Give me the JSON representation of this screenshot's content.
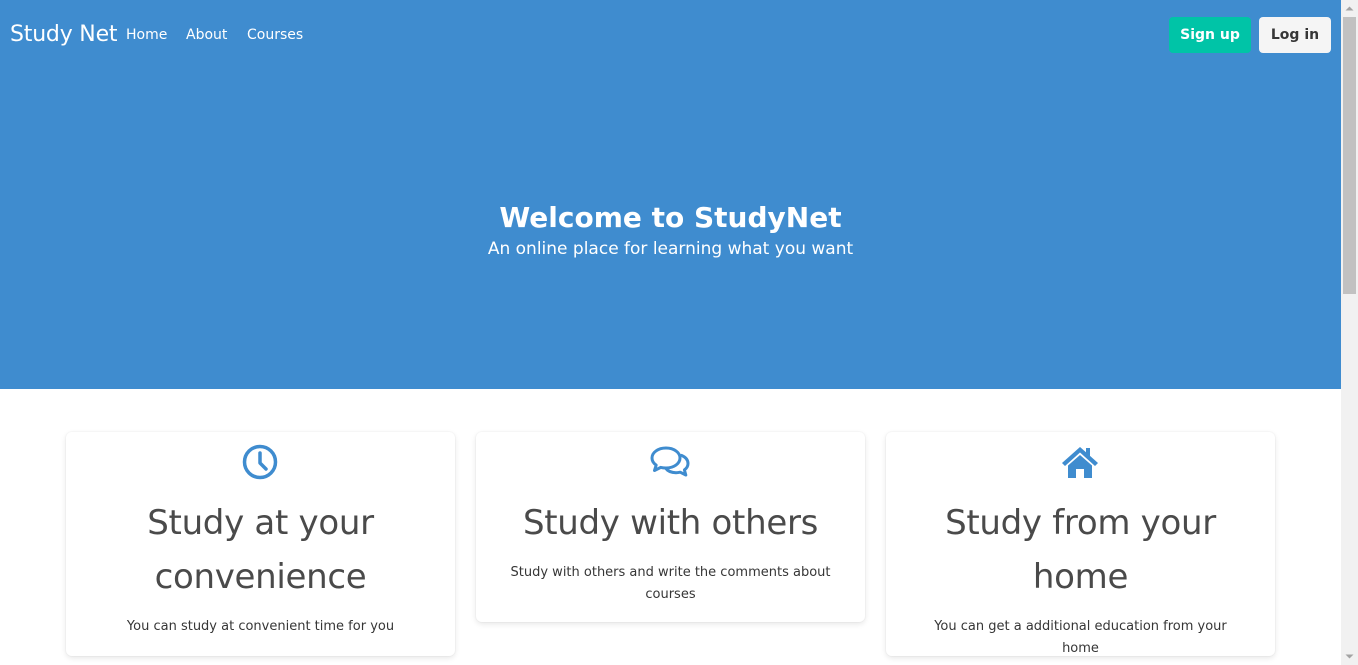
{
  "navbar": {
    "brand": "Study Net",
    "links": [
      {
        "label": "Home"
      },
      {
        "label": "About"
      },
      {
        "label": "Courses"
      }
    ],
    "signup_label": "Sign up",
    "login_label": "Log in"
  },
  "hero": {
    "title": "Welcome to StudyNet",
    "subtitle": "An online place for learning what you want"
  },
  "features": [
    {
      "icon": "clock-icon",
      "title": "Study at your convenience",
      "text": "You can study at convenient time for you"
    },
    {
      "icon": "comments-icon",
      "title": "Study with others",
      "text": "Study with others and write the comments about courses"
    },
    {
      "icon": "home-icon",
      "title": "Study from your home",
      "text": "You can get a additional education from your home"
    }
  ],
  "colors": {
    "hero_background": "#3f8ccf",
    "signup_button": "#00c4a7",
    "login_button": "#f5f5f5",
    "icon_color": "#3f8ccf",
    "heading_text": "#4a4a4a"
  }
}
